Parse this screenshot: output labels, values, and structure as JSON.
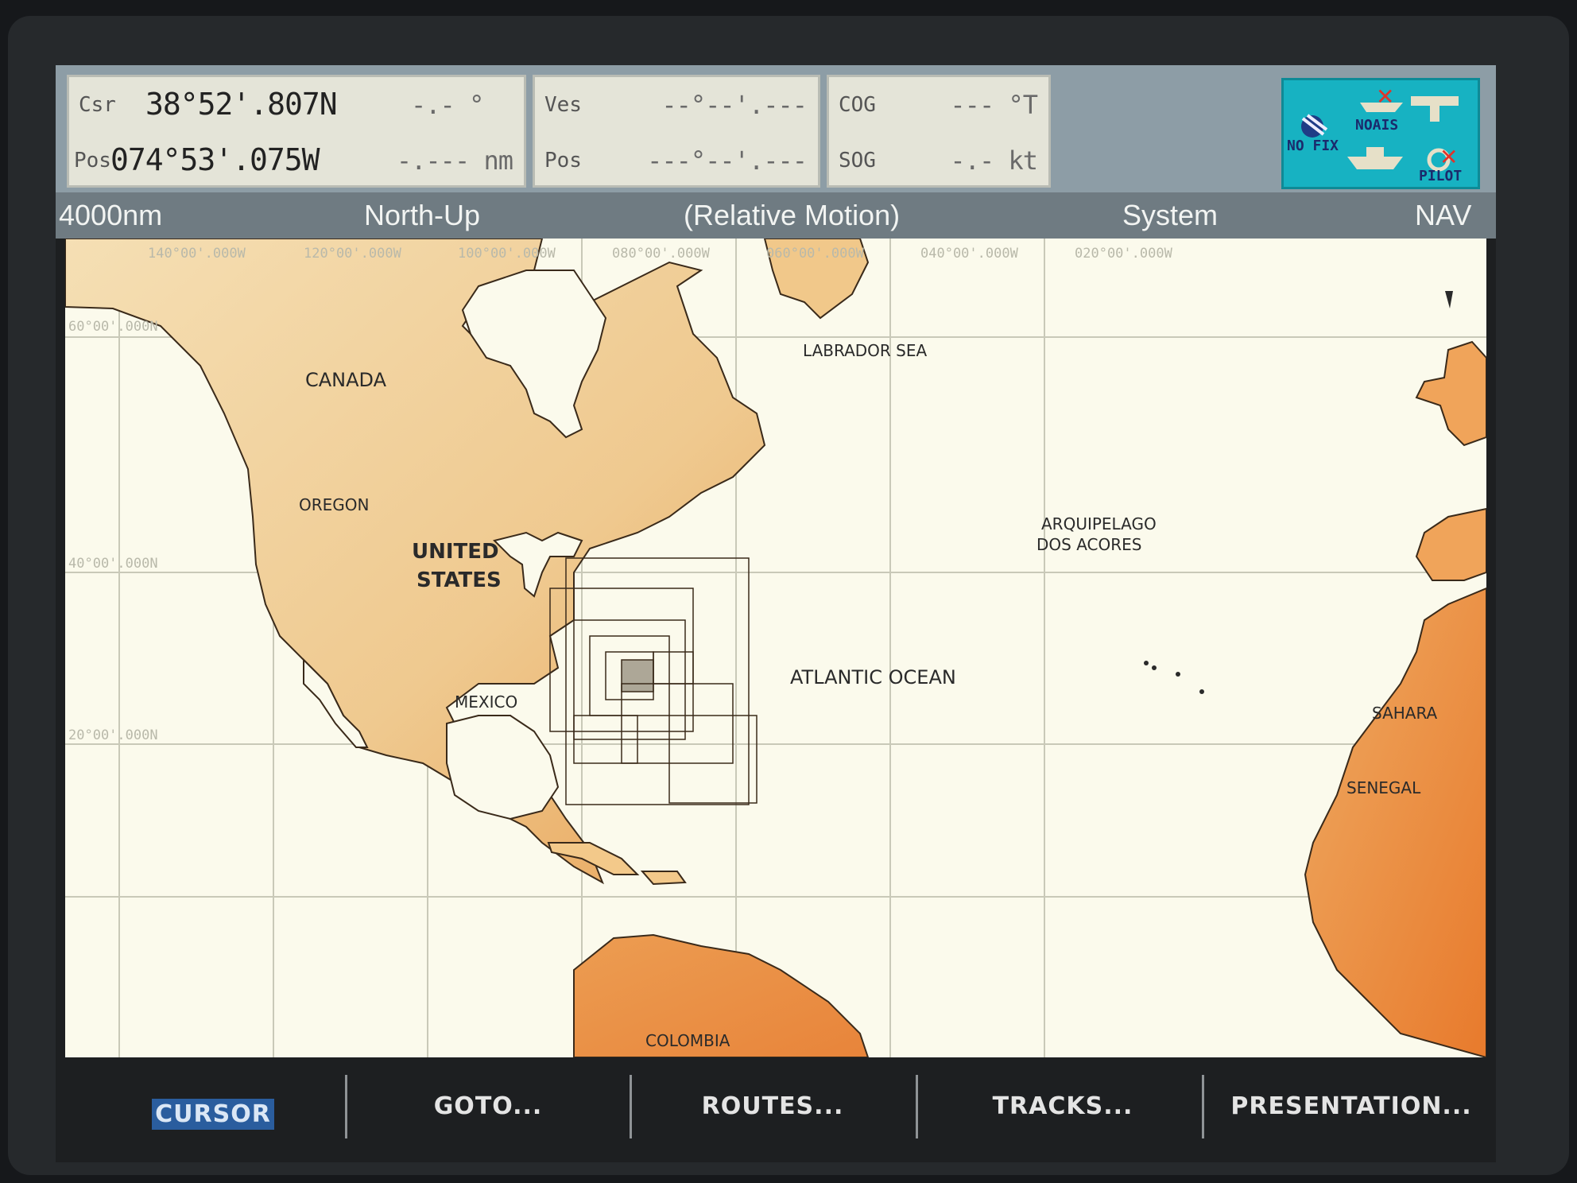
{
  "header": {
    "cursor_panel": {
      "label_top": "Csr",
      "label_bottom": "Pos",
      "latitude": "38°52'.807N",
      "longitude": "074°53'.075W",
      "bearing": "-.- °",
      "distance": "-.--- nm"
    },
    "vessel_panel": {
      "label_top": "Ves",
      "label_bottom": "Pos",
      "latitude": "--°--'.---",
      "longitude": "---°--'.---"
    },
    "nav_panel": {
      "cog_label": "COG",
      "cog_value": "--- °T",
      "sog_label": "SOG",
      "sog_value": "-.- kt"
    },
    "status": {
      "nofix": "NO FIX",
      "noais": "NOAIS",
      "pilot": "PILOT"
    }
  },
  "modebar": {
    "range": "4000nm",
    "orientation": "North-Up",
    "motion": "(Relative Motion)",
    "datum": "System",
    "mode": "NAV"
  },
  "chart": {
    "lon_labels": [
      "140°00'.000W",
      "120°00'.000W",
      "100°00'.000W",
      "080°00'.000W",
      "060°00'.000W",
      "040°00'.000W",
      "020°00'.000W"
    ],
    "lat_labels": [
      "60°00'.000N",
      "40°00'.000N",
      "20°00'.000N"
    ],
    "place_names": {
      "canada": "CANADA",
      "oregon": "OREGON",
      "united": "UNITED",
      "states": "STATES",
      "mexico": "MEXICO",
      "labrador_sea": "LABRADOR SEA",
      "azores_1": "ARQUIPELAGO",
      "azores_2": "DOS ACORES",
      "atlantic": "ATLANTIC OCEAN",
      "sahara": "SAHARA",
      "senegal": "SENEGAL",
      "colombia": "COLOMBIA"
    },
    "colors": {
      "land_light": "#f1d9a9",
      "land_dark": "#e89848",
      "sea": "#fbfaec",
      "grid": "#c9c9b8"
    }
  },
  "softkeys": {
    "cursor": "CURSOR",
    "goto": "GOTO...",
    "routes": "ROUTES...",
    "tracks": "TRACKS...",
    "presentation": "PRESENTATION..."
  }
}
